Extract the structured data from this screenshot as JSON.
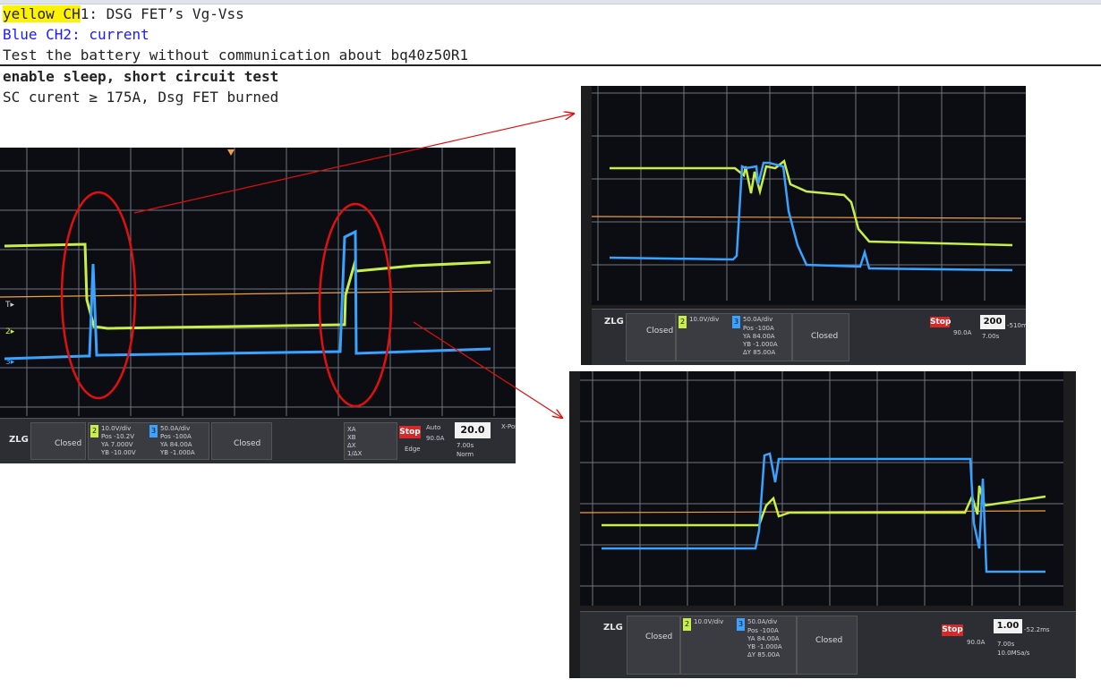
{
  "legend": {
    "ch1_highlight": "yellow CH",
    "ch1_rest": "1: DSG FET’s Vg-Vss",
    "ch2": "Blue CH2: current",
    "note": "Test the battery without communication about bq40z50R1"
  },
  "test": {
    "title": "enable sleep, short circuit test",
    "result": "SC curent ≥ 175A, Dsg FET burned"
  },
  "scope_left": {
    "ch2_scale": "10.0V/div",
    "ch2_lines": [
      "Pos  -10.2V",
      "YA   7.000V",
      "YB  -10.00V",
      "ΔY   17.00V"
    ],
    "ch3_scale": "50.0A/div",
    "ch3_lines": [
      "Pos  -100A",
      "YA   84.00A",
      "YB  -1.000A",
      "ΔY   85.00A"
    ],
    "ch1_status": "Closed",
    "ch4_status": "Closed",
    "run_state": "Stop",
    "timebase_value": "20.0",
    "timebase_unit": "ms/div",
    "trigger_mode": "Auto",
    "trigger_level": "90.0A",
    "trigger_type": "Edge",
    "delay": "7.00s",
    "xpos": "X-Pos",
    "xpos_value": "-130",
    "acq": "Norm",
    "sample_rate": "10.0MSa/s",
    "cursor_labels": [
      "XA",
      "XB",
      "ΔX",
      "1/ΔX"
    ]
  },
  "scope_top_right": {
    "ch1_status": "Closed",
    "ch4_status": "Closed",
    "ch2_scale": "10.0V/div",
    "ch3_scale": "50.0A/div",
    "ch3_lines": [
      "Pos  -100A",
      "YA   84.00A",
      "YB  -1.000A",
      "ΔY   85.00A"
    ],
    "run_state": "Stop",
    "timebase_value": "200",
    "timebase_unit": "µs/div",
    "xpos_value": "-510ms",
    "trigger_level": "90.0A",
    "delay": "7.00s",
    "sample_rate": "10.0MSa/s"
  },
  "scope_bottom_right": {
    "ch1_status": "Closed",
    "ch4_status": "Closed",
    "ch2_scale": "10.0V/div",
    "ch3_scale": "50.0A/div",
    "ch3_lines": [
      "Pos  -100A",
      "YA   84.00A",
      "YB  -1.000A",
      "ΔY   85.00A"
    ],
    "run_state": "Stop",
    "timebase_value": "1.00",
    "timebase_unit": "ms/div",
    "xpos_value": "-52.2ms",
    "trigger_level": "90.0A",
    "delay": "7.00s",
    "sample_rate": "10.0MSa/s"
  },
  "brand": "ZLG",
  "colors": {
    "ch1_yellow": "#c8ee4a",
    "ch2_blue": "#3aa2ff",
    "trigger_orange": "#f0a040",
    "annotation_red": "#e01010",
    "grid": "#8a8f98"
  }
}
